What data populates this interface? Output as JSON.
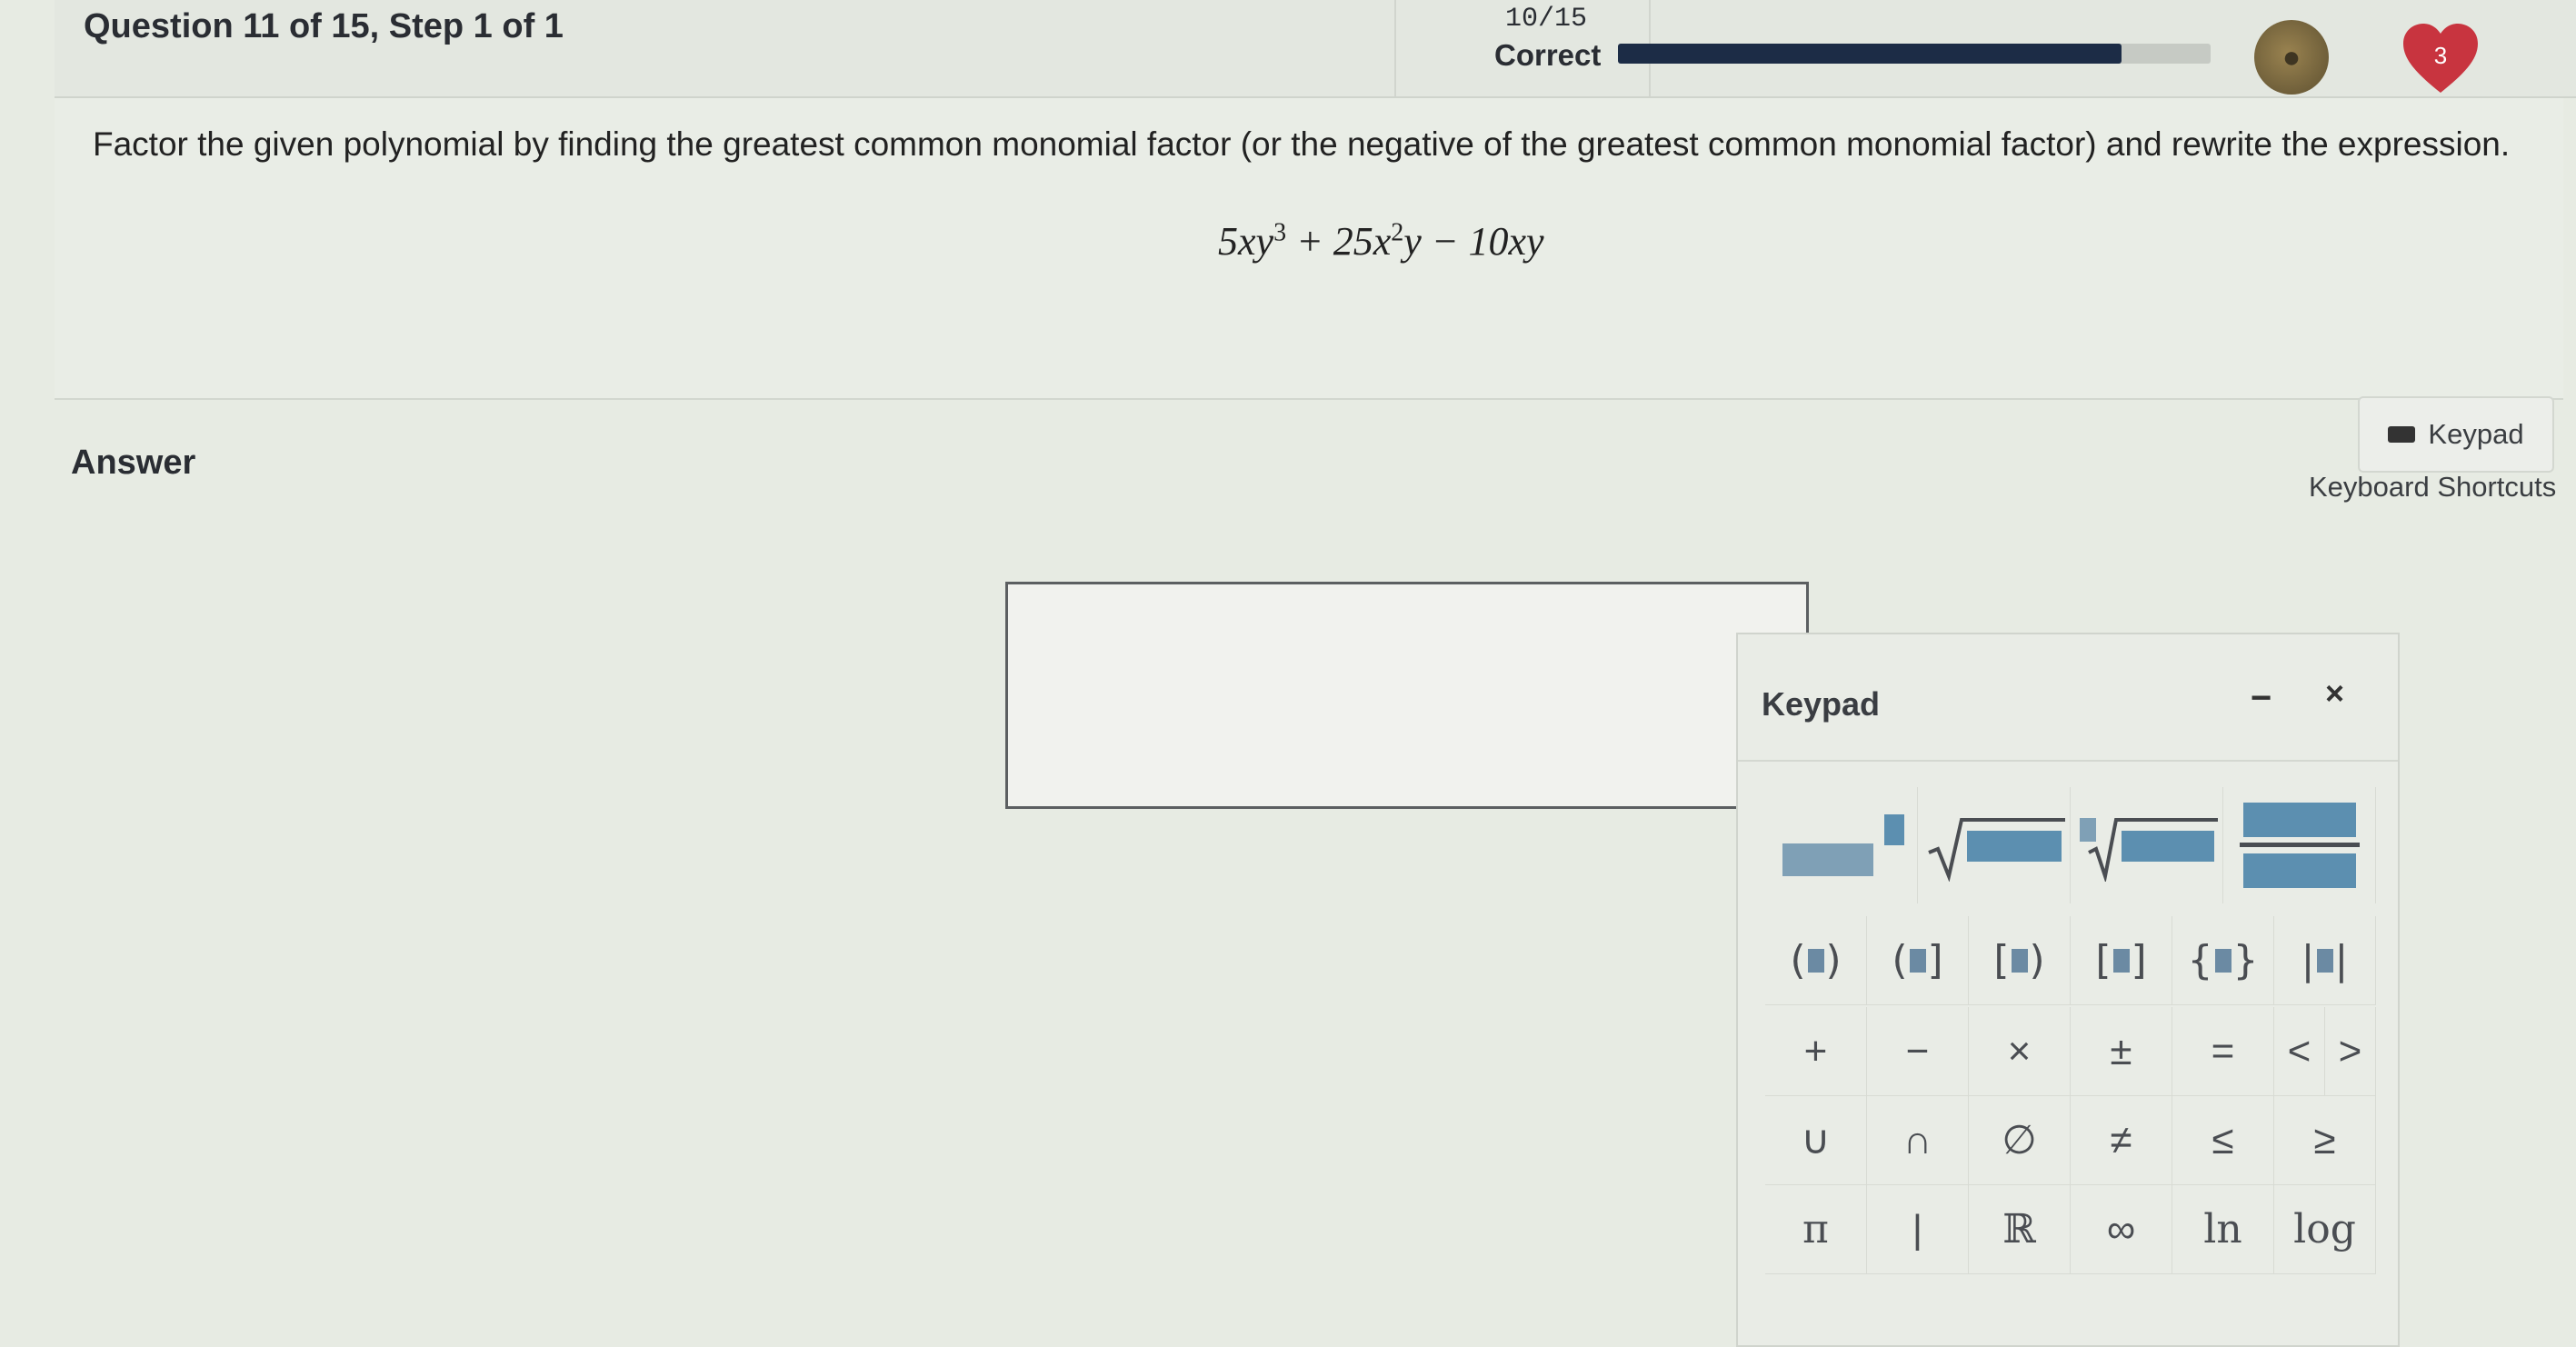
{
  "header": {
    "title": "Question 11 of 15, Step 1 of 1",
    "score": "10/15",
    "status": "Correct",
    "progress": 0.85,
    "hearts": "3"
  },
  "question": {
    "prompt": "Factor the given polynomial by finding the greatest common monomial factor (or the negative of the greatest common monomial factor) and rewrite the expression.",
    "expression": {
      "t1": "5xy",
      "e1": "3",
      "t2": " + 25x",
      "e2": "2",
      "t3": "y − 10xy"
    }
  },
  "answer": {
    "label": "Answer",
    "keypad_button": "Keypad",
    "shortcuts_link": "Keyboard Shortcuts",
    "input_value": ""
  },
  "keypad": {
    "title": "Keypad",
    "minimize": "−",
    "close": "×",
    "ops": [
      "+",
      "−",
      "×",
      "±",
      "=",
      "<",
      ">"
    ],
    "sets": [
      "∪",
      "∩",
      "∅",
      "≠",
      "≤",
      "≥"
    ],
    "misc": [
      "π",
      "|",
      "ℝ",
      "∞",
      "ln",
      "log"
    ]
  },
  "colors": {
    "accent": "#1c2c46",
    "placeholder_box": "#5c8fb0",
    "heart": "#c8343f"
  }
}
